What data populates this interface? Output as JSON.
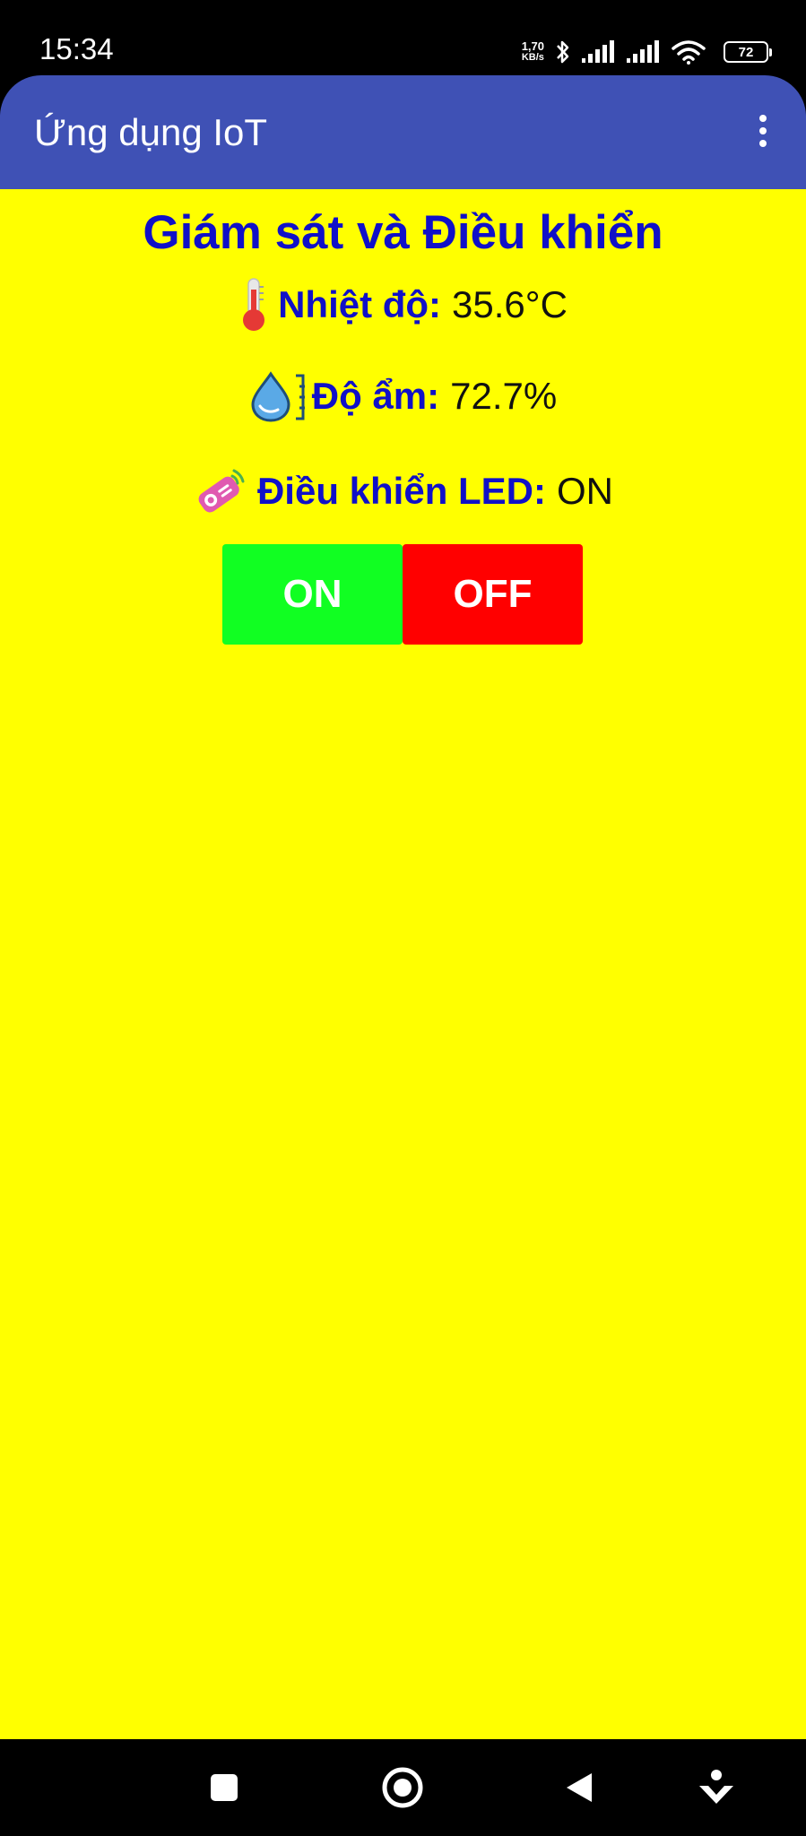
{
  "status_bar": {
    "time": "15:34",
    "net_speed_value": "1,70",
    "net_speed_unit": "KB/s",
    "battery_level": "72",
    "icons": [
      "bluetooth-icon",
      "signal-icon",
      "signal-icon",
      "wifi-icon",
      "battery-icon"
    ]
  },
  "app_bar": {
    "title": "Ứng dụng IoT",
    "menu_icon": "overflow-menu-icon"
  },
  "main": {
    "title": "Giám sát và Điều khiển",
    "temperature": {
      "icon": "thermometer-icon",
      "label": "Nhiệt độ:",
      "value": "35.6°C"
    },
    "humidity": {
      "icon": "humidity-drop-icon",
      "label": "Độ ẩm:",
      "value": "72.7%"
    },
    "led_control": {
      "icon": "remote-control-icon",
      "label": "Điều khiển LED:",
      "value": "ON"
    },
    "buttons": {
      "on_label": "ON",
      "off_label": "OFF"
    }
  },
  "nav_bar": {
    "icons": [
      "recents-square-icon",
      "home-circle-icon",
      "back-triangle-icon",
      "assistant-icon"
    ]
  },
  "colors": {
    "app_bar": "#3f51b5",
    "background": "#ffff00",
    "title_text": "#1010c8",
    "on_button": "#11ff22",
    "off_button": "#ff0000"
  }
}
